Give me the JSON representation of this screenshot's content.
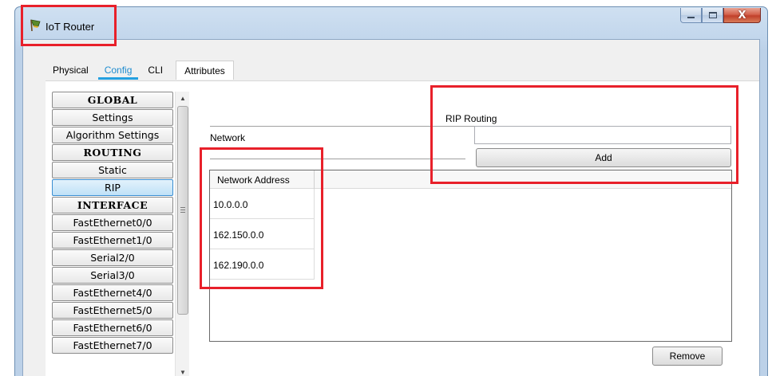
{
  "window": {
    "title": "IoT Router",
    "controls": {
      "minimize": "minimize-icon",
      "maximize": "maximize-icon",
      "close": "close-icon"
    }
  },
  "tabs": [
    {
      "label": "Physical"
    },
    {
      "label": "Config",
      "active": true
    },
    {
      "label": "CLI"
    },
    {
      "label": "Attributes"
    }
  ],
  "sidebar": {
    "items": [
      {
        "label": "GLOBAL",
        "type": "header"
      },
      {
        "label": "Settings"
      },
      {
        "label": "Algorithm Settings"
      },
      {
        "label": "ROUTING",
        "type": "header"
      },
      {
        "label": "Static"
      },
      {
        "label": "RIP",
        "selected": true
      },
      {
        "label": "INTERFACE",
        "type": "header"
      },
      {
        "label": "FastEthernet0/0"
      },
      {
        "label": "FastEthernet1/0"
      },
      {
        "label": "Serial2/0"
      },
      {
        "label": "Serial3/0"
      },
      {
        "label": "FastEthernet4/0"
      },
      {
        "label": "FastEthernet5/0"
      },
      {
        "label": "FastEthernet6/0"
      },
      {
        "label": "FastEthernet7/0"
      }
    ]
  },
  "rip": {
    "title": "RIP Routing",
    "network_label": "Network",
    "network_value": "",
    "add_label": "Add",
    "table": {
      "header": "Network Address",
      "rows": [
        "10.0.0.0",
        "162.150.0.0",
        "162.190.0.0"
      ]
    },
    "remove_label": "Remove"
  },
  "colors": {
    "highlight": "#e8202a",
    "accent": "#24a0e0"
  }
}
